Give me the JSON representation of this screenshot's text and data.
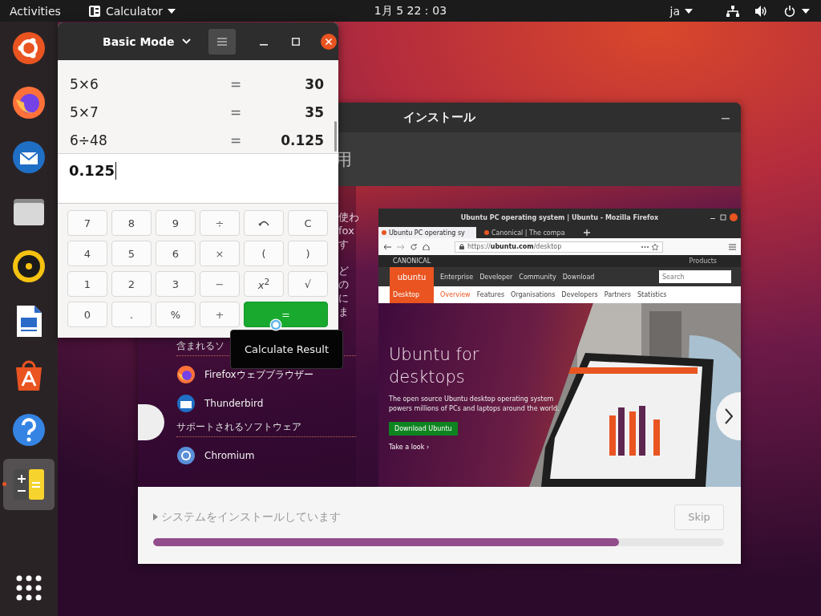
{
  "top_bar": {
    "activities": "Activities",
    "app_menu": "Calculator",
    "clock": "1月 5 22：03",
    "input_method": "ja"
  },
  "dock": {
    "items": [
      {
        "kind": "installer",
        "active": false
      },
      {
        "kind": "firefox",
        "active": false
      },
      {
        "kind": "thunderbird",
        "active": false
      },
      {
        "kind": "files",
        "active": false
      },
      {
        "kind": "rhythmbox",
        "active": false
      },
      {
        "kind": "writer",
        "active": false
      },
      {
        "kind": "software",
        "active": false
      },
      {
        "kind": "help",
        "active": false
      },
      {
        "kind": "calculator",
        "active": true
      }
    ]
  },
  "installer": {
    "title": "インストール",
    "heading_fragment": "用",
    "paragraphs": [
      [
        "使わ",
        "fox",
        "す"
      ],
      [
        "ど",
        "の",
        "に",
        "ま"
      ]
    ],
    "included_heading": "含まれるソ",
    "included": [
      {
        "kind": "firefox",
        "name": "Firefoxウェブブラウザー"
      },
      {
        "kind": "thunderbird",
        "name": "Thunderbird"
      }
    ],
    "supported_heading": "サポートされるソフトウェア",
    "supported": [
      {
        "kind": "chromium",
        "name": "Chromium"
      }
    ],
    "slide_screenshot": {
      "window_title": "Ubuntu PC operating system | Ubuntu - Mozilla Firefox",
      "tabs": [
        {
          "label": "Ubuntu PC operating sy",
          "selected": true
        },
        {
          "label": "Canonical | The compa",
          "selected": false
        }
      ],
      "url": "https://**ubuntu.com**/desktop",
      "company": "CANONICAL",
      "products": "Products",
      "logo": "ubuntu",
      "nav": [
        "Enterprise",
        "Developer",
        "Community",
        "Download"
      ],
      "search_placeholder": "Search",
      "section": "Desktop",
      "subnav": [
        {
          "label": "Overview",
          "selected": true
        },
        {
          "label": "Features",
          "selected": false
        },
        {
          "label": "Organisations",
          "selected": false
        },
        {
          "label": "Developers",
          "selected": false
        },
        {
          "label": "Partners",
          "selected": false
        },
        {
          "label": "Statistics",
          "selected": false
        }
      ],
      "hero_title": "Ubuntu for desktops",
      "hero_text": "The open source Ubuntu desktop operating system powers millions of PCs and laptops around the world.",
      "hero_button": "Download Ubuntu",
      "hero_link": "Take a look ›"
    },
    "status": "システムをインストールしています",
    "skip": {
      "label": "Skip",
      "disabled": true
    },
    "progress": {
      "level": 0.816
    }
  },
  "calculator": {
    "mode": "Basic Mode",
    "menu_pressed": true,
    "history": [
      {
        "expression": "5×6",
        "equals": "=",
        "result": "30"
      },
      {
        "expression": "5×7",
        "equals": "=",
        "result": "35"
      },
      {
        "expression": "6÷48",
        "equals": "=",
        "result": "0.125"
      }
    ],
    "display": "0.125",
    "keys": [
      {
        "kind": "digit",
        "label": "7"
      },
      {
        "kind": "digit",
        "label": "8"
      },
      {
        "kind": "digit",
        "label": "9"
      },
      {
        "kind": "operator",
        "label": "÷"
      },
      {
        "kind": "undo"
      },
      {
        "kind": "clear",
        "label": "C"
      },
      {
        "kind": "digit",
        "label": "4"
      },
      {
        "kind": "digit",
        "label": "5"
      },
      {
        "kind": "digit",
        "label": "6"
      },
      {
        "kind": "operator",
        "label": "×"
      },
      {
        "kind": "paren",
        "label": "("
      },
      {
        "kind": "paren",
        "label": ")"
      },
      {
        "kind": "digit",
        "label": "1"
      },
      {
        "kind": "digit",
        "label": "2"
      },
      {
        "kind": "digit",
        "label": "3"
      },
      {
        "kind": "operator",
        "label": "−"
      },
      {
        "kind": "power",
        "label": "*x*$^{2}$"
      },
      {
        "kind": "root",
        "label": "√"
      },
      {
        "kind": "digit",
        "label": "0"
      },
      {
        "kind": "point",
        "label": "."
      },
      {
        "kind": "percent",
        "label": "%"
      },
      {
        "kind": "operator",
        "label": "+"
      },
      {
        "kind": "equals",
        "label": "="
      }
    ],
    "tooltip": "Calculate Result"
  }
}
